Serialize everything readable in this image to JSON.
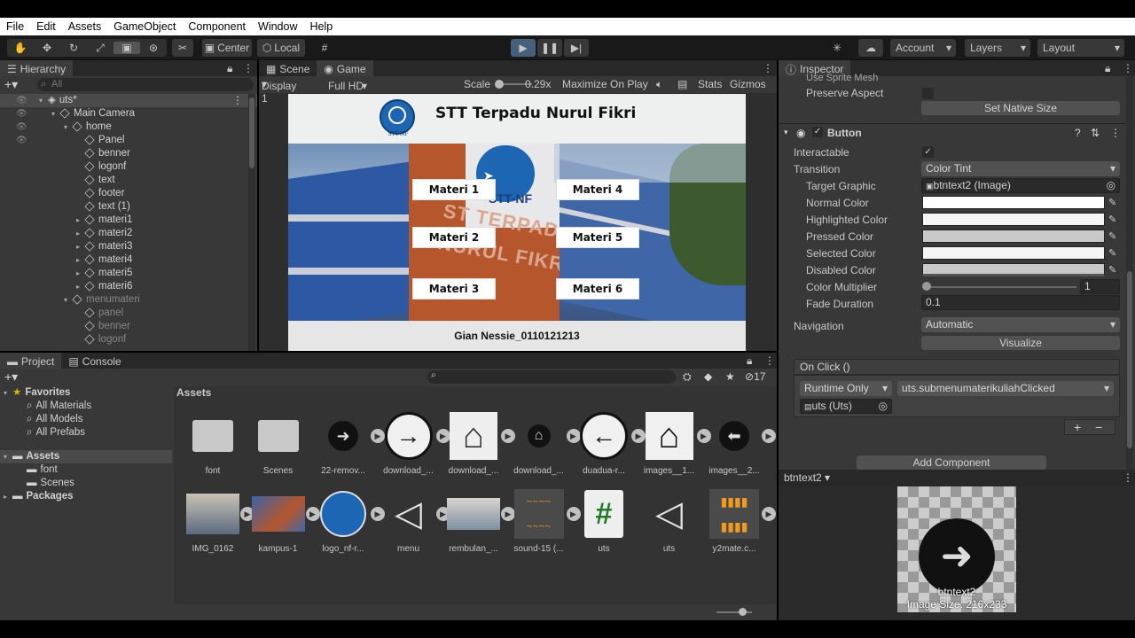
{
  "menu": [
    "File",
    "Edit",
    "Assets",
    "GameObject",
    "Component",
    "Window",
    "Help"
  ],
  "toolbar": {
    "center": "Center",
    "local": "Local",
    "account": "Account",
    "layers": "Layers",
    "layout": "Layout"
  },
  "hierarchy": {
    "title": "Hierarchy",
    "search": "All",
    "scene": "uts*",
    "items": [
      {
        "label": "Main Camera",
        "depth": 1,
        "dim": false,
        "arrow": "▾"
      },
      {
        "label": "home",
        "depth": 2,
        "dim": false,
        "arrow": "▾"
      },
      {
        "label": "Panel",
        "depth": 3,
        "dim": false,
        "arrow": ""
      },
      {
        "label": "benner",
        "depth": 3,
        "dim": false,
        "arrow": ""
      },
      {
        "label": "logonf",
        "depth": 3,
        "dim": false,
        "arrow": ""
      },
      {
        "label": "text",
        "depth": 3,
        "dim": false,
        "arrow": ""
      },
      {
        "label": "footer",
        "depth": 3,
        "dim": false,
        "arrow": ""
      },
      {
        "label": "text (1)",
        "depth": 3,
        "dim": false,
        "arrow": ""
      },
      {
        "label": "materi1",
        "depth": 3,
        "dim": false,
        "arrow": "▸"
      },
      {
        "label": "materi2",
        "depth": 3,
        "dim": false,
        "arrow": "▸"
      },
      {
        "label": "materi3",
        "depth": 3,
        "dim": false,
        "arrow": "▸"
      },
      {
        "label": "materi4",
        "depth": 3,
        "dim": false,
        "arrow": "▸"
      },
      {
        "label": "materi5",
        "depth": 3,
        "dim": false,
        "arrow": "▸"
      },
      {
        "label": "materi6",
        "depth": 3,
        "dim": false,
        "arrow": "▸"
      },
      {
        "label": "menumateri",
        "depth": 2,
        "dim": true,
        "arrow": "▾"
      },
      {
        "label": "panel",
        "depth": 3,
        "dim": true,
        "arrow": ""
      },
      {
        "label": "benner",
        "depth": 3,
        "dim": true,
        "arrow": ""
      },
      {
        "label": "logonf",
        "depth": 3,
        "dim": true,
        "arrow": ""
      }
    ]
  },
  "game": {
    "scene_tab": "Scene",
    "game_tab": "Game",
    "display": "Display 1",
    "resolution": "Full HD (1920x1080)",
    "scale_label": "Scale",
    "scale_value": "0.29x",
    "maximize": "Maximize On Play",
    "stats": "Stats",
    "gizmos": "Gizmos",
    "header_title": "STT Terpadu Nurul Fikri",
    "logo_text": "STT-NF",
    "building_text1": "ST TERPADU",
    "building_text2": "NURUL FIKRI",
    "building_sign": "STT-NF",
    "buttons": [
      "Materi 1",
      "Materi 2",
      "Materi 3",
      "Materi 4",
      "Materi 5",
      "Materi 6"
    ],
    "footer": "Gian Nessie_0110121213"
  },
  "project": {
    "project_tab": "Project",
    "console_tab": "Console",
    "count": "17",
    "favorites": "Favorites",
    "fav_items": [
      "All Materials",
      "All Models",
      "All Prefabs"
    ],
    "assets_root": "Assets",
    "asset_children": [
      "font",
      "Scenes"
    ],
    "packages": "Packages",
    "breadcrumb": "Assets",
    "assets_row1": [
      "font",
      "Scenes",
      "22-remov...",
      "download_...",
      "download_...",
      "download_...",
      "duadua-r...",
      "images__1...",
      "images__2..."
    ],
    "assets_row2": [
      "IMG_0162",
      "kampus-1",
      "logo_nf-r...",
      "menu",
      "rembulan_...",
      "sound-15 (...",
      "uts",
      "uts",
      "y2mate.c..."
    ]
  },
  "inspector": {
    "title": "Inspector",
    "use_sprite_mesh": "Use Sprite Mesh",
    "preserve_aspect": "Preserve Aspect",
    "set_native_size": "Set Native Size",
    "component": "Button",
    "interactable": "Interactable",
    "transition": "Transition",
    "transition_value": "Color Tint",
    "target_graphic": "Target Graphic",
    "target_graphic_value": "btntext2 (Image)",
    "normal_color": "Normal Color",
    "highlighted_color": "Highlighted Color",
    "pressed_color": "Pressed Color",
    "selected_color": "Selected Color",
    "disabled_color": "Disabled Color",
    "color_multiplier": "Color Multiplier",
    "color_multiplier_value": "1",
    "fade_duration": "Fade Duration",
    "fade_duration_value": "0.1",
    "navigation": "Navigation",
    "navigation_value": "Automatic",
    "visualize": "Visualize",
    "on_click": "On Click ()",
    "runtime": "Runtime Only",
    "function": "uts.submenumaterikuliahClicked",
    "object": "uts (Uts)",
    "add_component": "Add Component",
    "plus": "+",
    "minus": "−"
  },
  "preview": {
    "name": "btntext2",
    "label": "btntext2",
    "size": "Image Size: 216x233"
  },
  "colors": {
    "accent": "#46607c",
    "panel": "#383838"
  }
}
